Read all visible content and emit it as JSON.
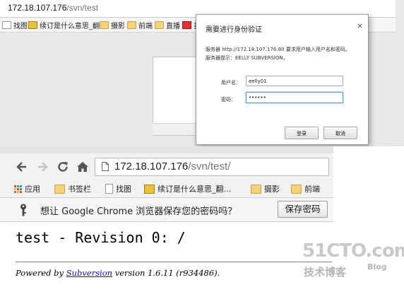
{
  "top_window": {
    "url_host": "172.18.107.176",
    "url_path": "/svn/test",
    "bookmarks": [
      "找图",
      "续订是什么意思_翻...",
      "摄影",
      "前端",
      "直播",
      "扌"
    ],
    "dialog": {
      "title": "需要进行身份验证",
      "close_label": "×",
      "message_line1": "服务器 http://172.18.107.176:80 要求用户输入用户名和密码。",
      "message_line2": "服务器提示：EELLY SUBVERSION。",
      "username_label": "用户名：",
      "username_value": "eelly01",
      "password_label": "密码：",
      "password_value": "••••••",
      "login_label": "登录",
      "cancel_label": "取消"
    }
  },
  "bottom_window": {
    "url_host": "172.18.107.176",
    "url_path": "/svn/test/",
    "bookmarks": [
      "应用",
      "书签栏",
      "找图",
      "续订是什么意思_翻...",
      "摄影",
      "前端"
    ],
    "infobar_text": "想让 Google Chrome 浏览器保存您的密码吗？",
    "save_password_label": "保存密码",
    "page_title": "test - Revision 0: /",
    "footer_prefix": "Powered by ",
    "footer_link": "Subversion",
    "footer_suffix": " version 1.6.11 (r934486)."
  },
  "watermark": {
    "main": "51CTO.com",
    "sub": "技术博客",
    "blog": "Blog"
  }
}
